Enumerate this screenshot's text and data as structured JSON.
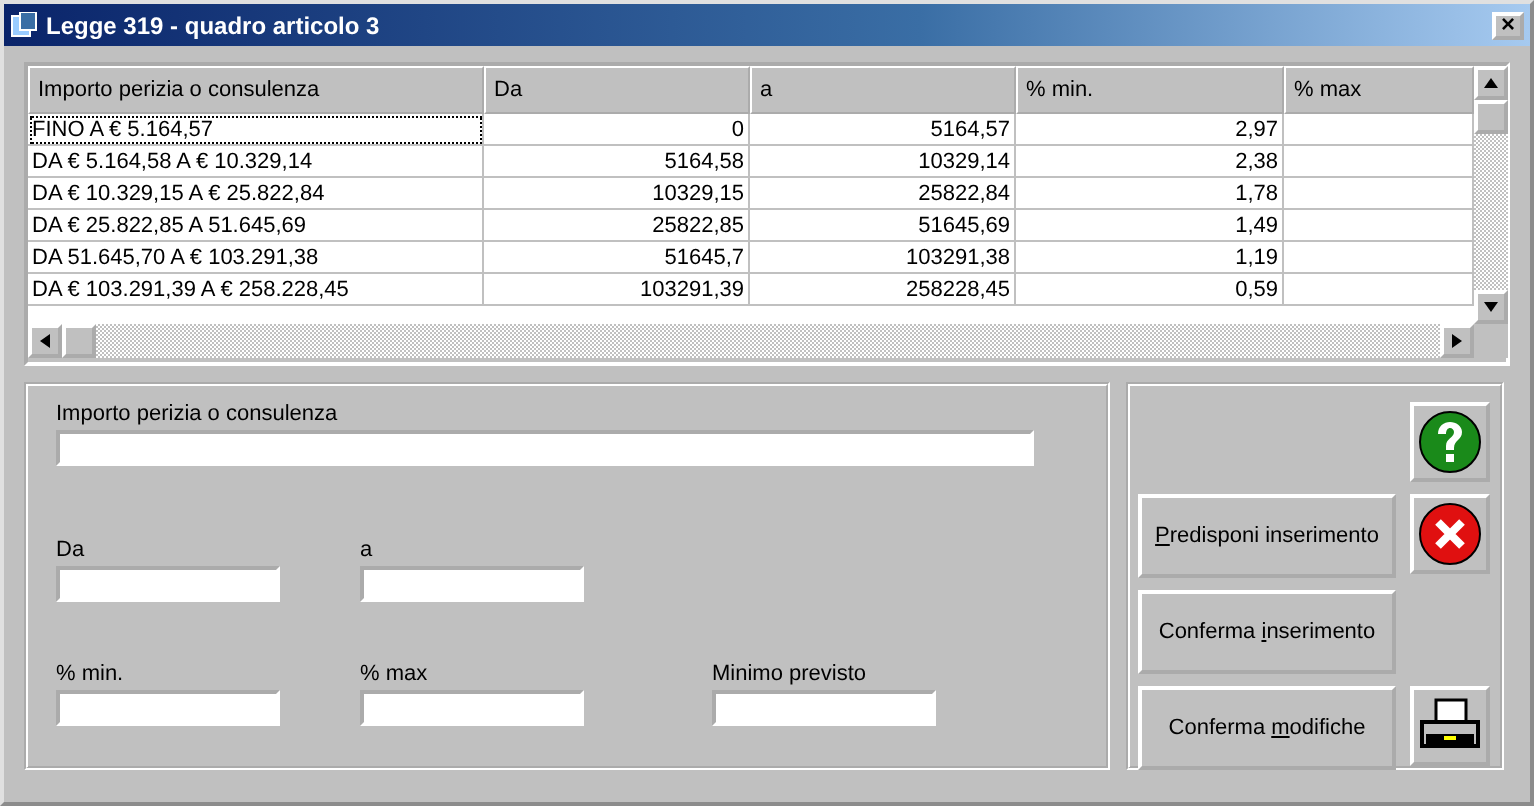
{
  "window": {
    "title": "Legge 319 - quadro articolo 3",
    "close": "×"
  },
  "table": {
    "columns": [
      "Importo perizia o consulenza",
      "Da",
      "a",
      "% min.",
      "% max"
    ],
    "rows": [
      {
        "cells": [
          "FINO A € 5.164,57",
          "0",
          "5164,57",
          "2,97",
          ""
        ],
        "focused": true
      },
      {
        "cells": [
          "DA € 5.164,58 A € 10.329,14",
          "5164,58",
          "10329,14",
          "2,38",
          ""
        ],
        "focused": false
      },
      {
        "cells": [
          "DA € 10.329,15 A € 25.822,84",
          "10329,15",
          "25822,84",
          "1,78",
          ""
        ],
        "focused": false
      },
      {
        "cells": [
          "DA € 25.822,85 A  51.645,69",
          "25822,85",
          "51645,69",
          "1,49",
          ""
        ],
        "focused": false
      },
      {
        "cells": [
          "DA  51.645,70 A € 103.291,38",
          "51645,7",
          "103291,38",
          "1,19",
          ""
        ],
        "focused": false
      },
      {
        "cells": [
          "DA € 103.291,39 A € 258.228,45",
          "103291,39",
          "258228,45",
          "0,59",
          ""
        ],
        "focused": false
      }
    ]
  },
  "form": {
    "fields": [
      {
        "label": "Importo perizia o consulenza",
        "kind": "wide"
      },
      {
        "label": "Da",
        "kind": "short"
      },
      {
        "label": "a",
        "kind": "short"
      },
      {
        "label": "% min.",
        "kind": "short"
      },
      {
        "label": "% max",
        "kind": "short"
      },
      {
        "label": "Minimo previsto",
        "kind": "short"
      }
    ]
  },
  "actions": [
    {
      "kind": "help"
    },
    {
      "kind": "text",
      "key": "P",
      "after": "redisponi inserimento"
    },
    {
      "kind": "cancel"
    },
    {
      "kind": "text",
      "before": "Conferma ",
      "key": "i",
      "after": "nserimento"
    },
    {
      "kind": "text",
      "before": "Conferma ",
      "key": "m",
      "after": "odifiche"
    },
    {
      "kind": "print"
    }
  ]
}
